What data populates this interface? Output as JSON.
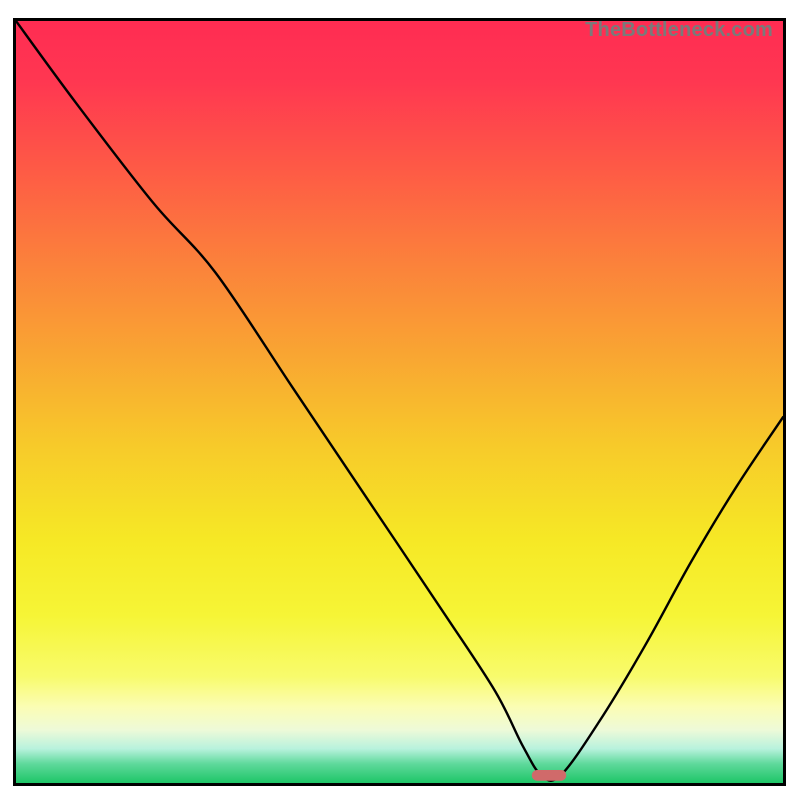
{
  "watermark": "TheBottleneck.com",
  "chart_data": {
    "type": "line",
    "title": "",
    "xlabel": "",
    "ylabel": "",
    "xlim": [
      0,
      100
    ],
    "ylim": [
      0,
      100
    ],
    "series": [
      {
        "name": "curve",
        "x": [
          0,
          8,
          18,
          26,
          36,
          46,
          56,
          62.5,
          66,
          68.5,
          71,
          76,
          82,
          88,
          94,
          100
        ],
        "y": [
          100,
          89,
          76,
          67,
          52,
          37,
          22,
          12,
          5,
          1,
          1,
          8,
          18,
          29,
          39,
          48
        ]
      }
    ],
    "marker": {
      "x": 69.5,
      "y": 1,
      "w": 4.5,
      "h": 1.4,
      "color": "#d06a6a",
      "rx": 1.0
    },
    "gradient_stops": [
      {
        "offset": 0.0,
        "color": "#ff2c52"
      },
      {
        "offset": 0.08,
        "color": "#ff3751"
      },
      {
        "offset": 0.2,
        "color": "#fe5c45"
      },
      {
        "offset": 0.32,
        "color": "#fb823b"
      },
      {
        "offset": 0.44,
        "color": "#f9a632"
      },
      {
        "offset": 0.56,
        "color": "#f7cb2a"
      },
      {
        "offset": 0.68,
        "color": "#f6e825"
      },
      {
        "offset": 0.78,
        "color": "#f6f536"
      },
      {
        "offset": 0.86,
        "color": "#f8fb6c"
      },
      {
        "offset": 0.9,
        "color": "#fbfdb4"
      },
      {
        "offset": 0.93,
        "color": "#eefad8"
      },
      {
        "offset": 0.955,
        "color": "#b8f2dd"
      },
      {
        "offset": 0.975,
        "color": "#5ed99b"
      },
      {
        "offset": 1.0,
        "color": "#1ec667"
      }
    ]
  }
}
